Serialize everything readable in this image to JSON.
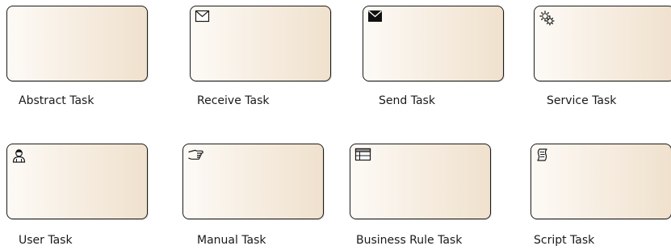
{
  "tasks": [
    {
      "label": "Abstract Task",
      "icon": ""
    },
    {
      "label": "Receive Task",
      "icon": "envelope-outline-icon"
    },
    {
      "label": "Send Task",
      "icon": "envelope-filled-icon"
    },
    {
      "label": "Service Task",
      "icon": "gears-icon"
    },
    {
      "label": "User Task",
      "icon": "user-icon"
    },
    {
      "label": "Manual Task",
      "icon": "hand-icon"
    },
    {
      "label": "Business Rule Task",
      "icon": "table-icon"
    },
    {
      "label": "Script Task",
      "icon": "scroll-icon"
    }
  ],
  "colors": {
    "fill_light": "#fdfaf6",
    "fill_dark": "#efe1cd",
    "stroke": "#1a1a1a"
  }
}
